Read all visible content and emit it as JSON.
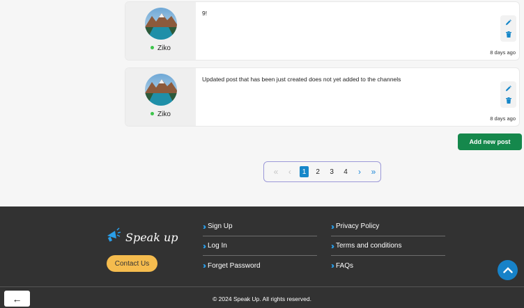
{
  "posts": [
    {
      "author": "Ziko",
      "text": "9!",
      "date": "8 days ago"
    },
    {
      "author": "Ziko",
      "text": "Updated post that has been just created does not yet added to the channels",
      "date": "8 days ago"
    }
  ],
  "add_post_label": "Add new post",
  "pagination": {
    "pages": [
      "1",
      "2",
      "3",
      "4"
    ],
    "current": "1",
    "first_icon": "«",
    "prev_icon": "‹",
    "next_icon": "›",
    "last_icon": "»"
  },
  "footer": {
    "brand": "Speak up",
    "contact_label": "Contact Us",
    "links_col1": [
      "Sign Up",
      "Log In",
      "Forget Password"
    ],
    "links_col2": [
      "Privacy Policy",
      "Terms and conditions",
      "FAQs"
    ],
    "copyright": "© 2024 Speak Up. All rights reserved.",
    "back_icon": "←"
  },
  "colors": {
    "accent_green": "#15884c",
    "accent_blue": "#1687c9",
    "contact_yellow": "#f5bc4e",
    "footer_bg": "#323232",
    "online": "#3cc44a"
  },
  "icons": [
    "pencil-icon",
    "trash-icon",
    "megaphone-icon",
    "chevron-double-right-icon",
    "chevron-up-icon",
    "arrow-left-icon"
  ]
}
